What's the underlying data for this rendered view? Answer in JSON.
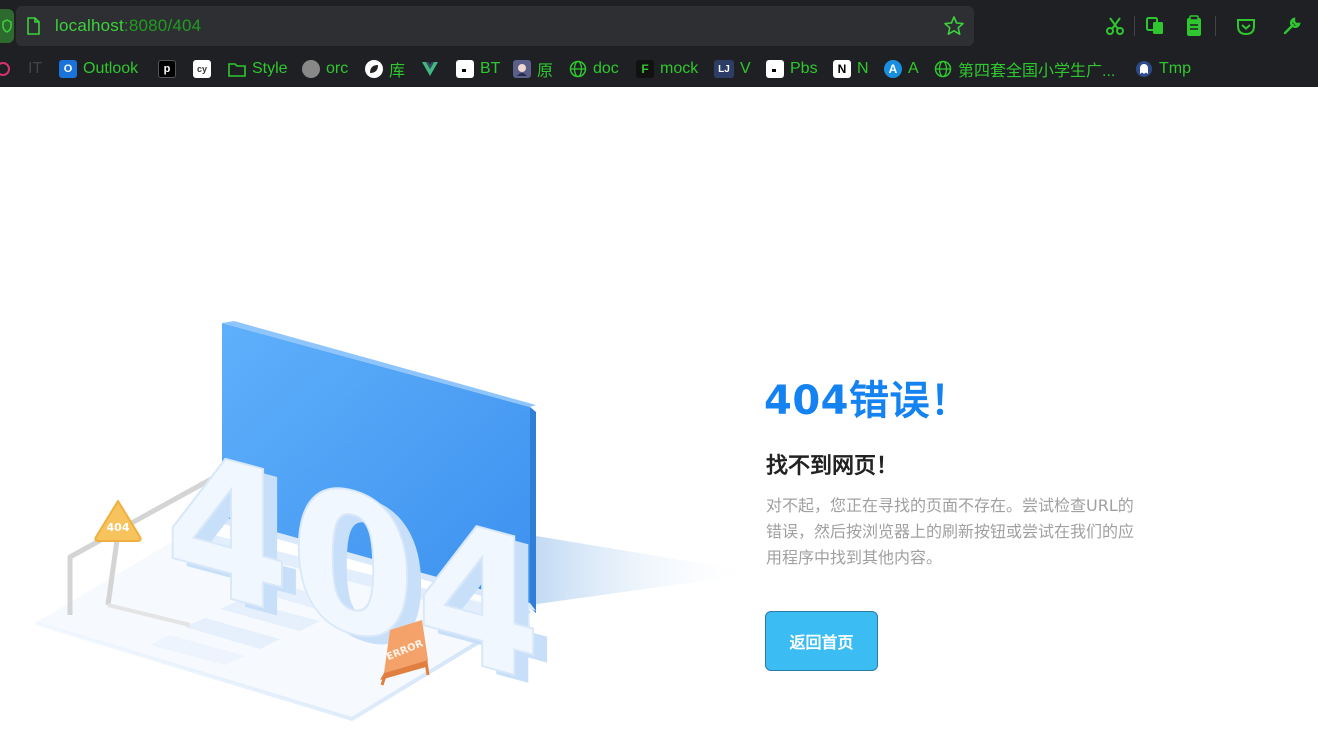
{
  "browser": {
    "url_host": "localhost",
    "url_rest": ":8080/404",
    "toolbar_icons": [
      "scissors-icon",
      "copy-icon",
      "clipboard-icon",
      "pocket-icon",
      "wrench-icon"
    ],
    "accent_color": "#2fc72f",
    "bookmarks": [
      {
        "label": "",
        "icon": "flower-icon"
      },
      {
        "label": "IT",
        "icon": "text-icon"
      },
      {
        "label": "Outlook",
        "icon": "outlook-icon"
      },
      {
        "label": "",
        "icon": "p-icon"
      },
      {
        "label": "",
        "icon": "cy-icon"
      },
      {
        "label": "Style",
        "icon": "folder-icon"
      },
      {
        "label": "orc",
        "icon": "orc-icon"
      },
      {
        "label": "库",
        "icon": "leaf-icon"
      },
      {
        "label": "",
        "icon": "vue-icon"
      },
      {
        "label": "BT",
        "icon": "page-icon"
      },
      {
        "label": "原",
        "icon": "avatar-icon"
      },
      {
        "label": "doc",
        "icon": "globe-icon"
      },
      {
        "label": "mock",
        "icon": "f-icon"
      },
      {
        "label": "V",
        "icon": "lj-icon"
      },
      {
        "label": "Pbs",
        "icon": "page-icon"
      },
      {
        "label": "N",
        "icon": "notion-icon"
      },
      {
        "label": "A",
        "icon": "a-icon"
      },
      {
        "label": "第四套全国小学生广...",
        "icon": "globe-icon"
      },
      {
        "label": "Tmp",
        "icon": "ghost-icon"
      }
    ]
  },
  "page": {
    "title": "404错误！",
    "subtitle": "找不到网页！",
    "description": "对不起，您正在寻找的页面不存在。尝试检查URL的错误，然后按浏览器上的刷新按钮或尝试在我们的应用程序中找到其他内容。",
    "home_button": "返回首页",
    "illustration_text": "404",
    "sign_404": "404",
    "sign_error": "ERROR",
    "title_color": "#1482f0",
    "button_color": "#3bbcf2"
  }
}
